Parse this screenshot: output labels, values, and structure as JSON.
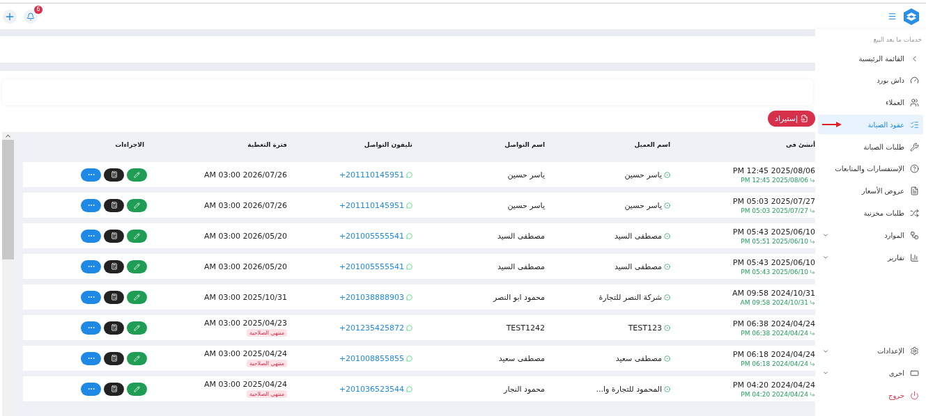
{
  "topbar": {
    "notification_count": "6"
  },
  "sidebar": {
    "section": "خدمات ما بعد البيع",
    "items": [
      {
        "label": "القائمة الرئيسية",
        "kind": "back",
        "selected": false
      },
      {
        "label": "داش بورد",
        "kind": "link",
        "selected": false
      },
      {
        "label": "العملاء",
        "kind": "link",
        "selected": false
      },
      {
        "label": "عقود الصيانة",
        "kind": "link",
        "selected": true,
        "pointer": true
      },
      {
        "label": "طلبات الصيانة",
        "kind": "link",
        "selected": false
      },
      {
        "label": "الإستفسارات والمتابعات",
        "kind": "link",
        "selected": false
      },
      {
        "label": "عروض الأسعار",
        "kind": "link",
        "selected": false
      },
      {
        "label": "طلبات مخزنية",
        "kind": "link",
        "selected": false
      },
      {
        "label": "الموارد",
        "kind": "group",
        "selected": false
      },
      {
        "label": "تقارير",
        "kind": "group",
        "selected": false
      }
    ],
    "footer_items": [
      {
        "label": "الإعدادات",
        "kind": "group",
        "selected": false
      },
      {
        "label": "اخرى",
        "kind": "group",
        "selected": false
      },
      {
        "label": "خروج",
        "kind": "logout",
        "selected": false
      }
    ]
  },
  "import_button": "إستيراد",
  "table": {
    "columns": [
      "أنشئ فى",
      "اسم العميل",
      "اسم التواصل",
      "تليفون التواصل",
      "فترة التغطية",
      "الاجراءات"
    ],
    "rows": [
      {
        "created": "PM 12:45 2025/08/06",
        "updated": "PM 12:45 2025/08/06",
        "customer": "ياسر حسين",
        "contact": "ياسر حسين",
        "phone": "+201110145951",
        "coverage": "AM 03:00 2026/07/26",
        "expired": false
      },
      {
        "created": "PM 05:03 2025/07/27",
        "updated": "PM 05:03 2025/07/27",
        "customer": "ياسر حسين",
        "contact": "ياسر حسين",
        "phone": "+201110145951",
        "coverage": "AM 03:00 2026/07/26",
        "expired": false
      },
      {
        "created": "PM 05:43 2025/06/10",
        "updated": "PM 05:51 2025/06/10",
        "customer": "مصطفى السيد",
        "contact": "مصطفى السيد",
        "phone": "+201005555541",
        "coverage": "AM 03:00 2026/05/20",
        "expired": false
      },
      {
        "created": "PM 05:43 2025/06/10",
        "updated": "PM 05:43 2025/06/10",
        "customer": "مصطفى السيد",
        "contact": "مصطفى السيد",
        "phone": "+201005555541",
        "coverage": "AM 03:00 2026/05/20",
        "expired": false
      },
      {
        "created": "AM 09:58 2024/10/31",
        "updated": "AM 09:58 2024/10/31",
        "customer": "شركة النصر للتجارة",
        "contact": "محمود ابو النصر",
        "phone": "+201038888903",
        "coverage": "AM 03:00 2025/10/31",
        "expired": false
      },
      {
        "created": "PM 06:38 2024/04/24",
        "updated": "PM 06:38 2024/04/24",
        "customer": "TEST123",
        "contact": "TEST1242",
        "phone": "+201235425872",
        "coverage": "AM 03:00 2025/04/23",
        "expired": true,
        "badge": "منتهي الصلاحية"
      },
      {
        "created": "PM 06:18 2024/04/24",
        "updated": "PM 06:18 2024/04/24",
        "customer": "مصطفى سعيد",
        "contact": "مصطفى سعيد",
        "phone": "+201008855855",
        "coverage": "AM 03:00 2025/04/24",
        "expired": true,
        "badge": "منتهي الصلاحية"
      },
      {
        "created": "PM 04:20 2024/04/24",
        "updated": "PM 04:20 2024/04/24",
        "customer": "المحمود للتجارة وا...",
        "contact": "محمود النجار",
        "phone": "+201036523544",
        "coverage": "AM 03:00 2025/04/24",
        "expired": true,
        "badge": "منتهي الصلاحية"
      }
    ]
  }
}
